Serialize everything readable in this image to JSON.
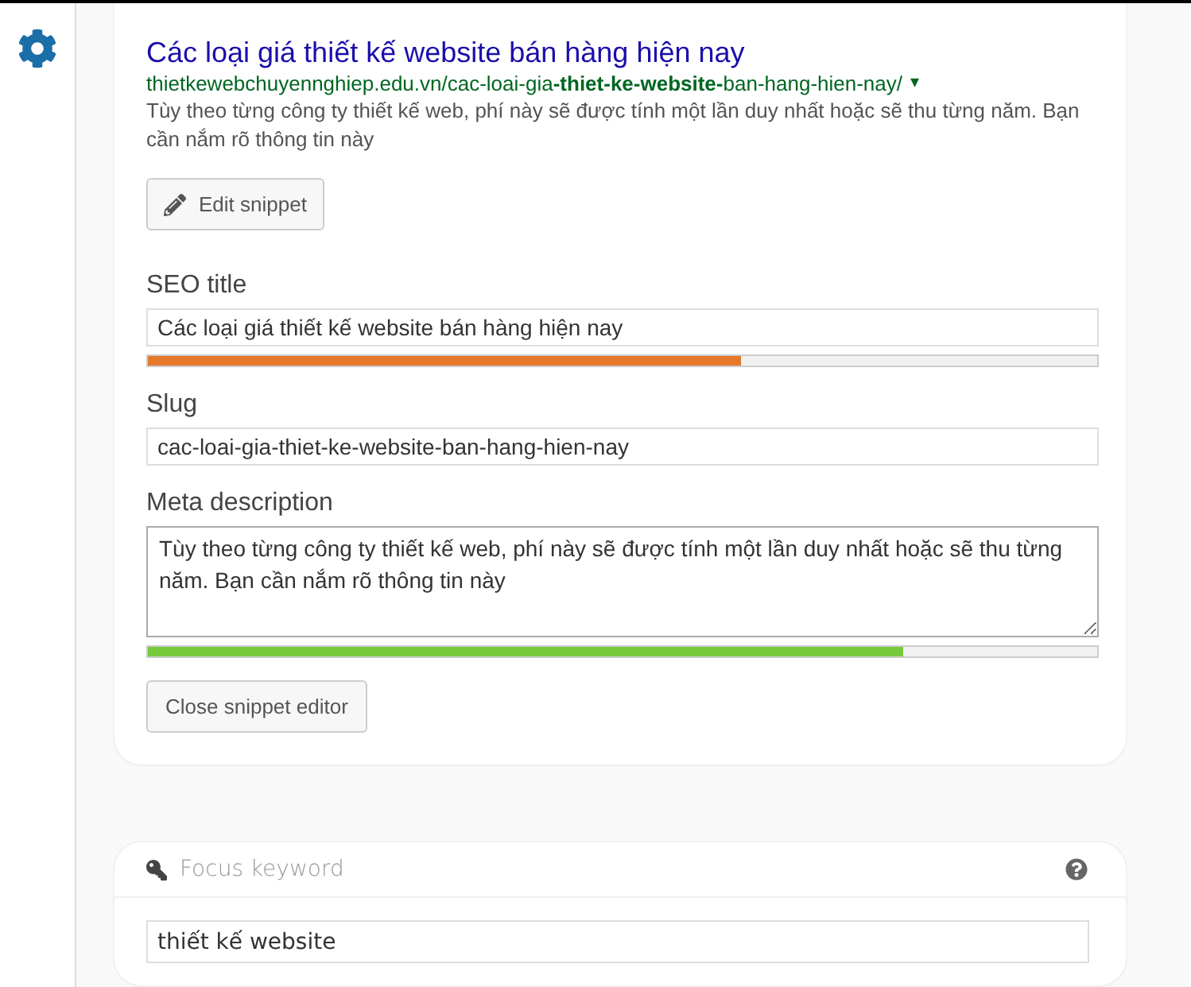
{
  "snippet": {
    "title": "Các loại giá thiết kế website bán hàng hiện nay",
    "url": "thietkewebchuyennghiep.edu.vn/cac-loai-gia**-thiet-ke-website-**ban-hang-hien-nay/",
    "url_caret": "▾",
    "description": "Tùy theo từng công ty thiết kế web, phí này sẽ được tính một lần duy nhất hoặc sẽ thu từng năm. Bạn cần nắm rõ thông tin này",
    "edit_button": "Edit snippet"
  },
  "fields": [
    {
      "kind": "input",
      "label": "SEO title",
      "value": "Các loại giá thiết kế website bán hàng hiện nay",
      "meter": {
        "level": 0.625,
        "color": "#e5782b"
      }
    },
    {
      "kind": "input",
      "label": "Slug",
      "value": "cac-loai-gia-thiet-ke-website-ban-hang-hien-nay"
    },
    {
      "kind": "textarea",
      "label": "Meta description",
      "value": "Tùy theo từng công ty thiết kế web, phí này sẽ được tính một lần duy nhất hoặc sẽ thu từng năm. Bạn cần nắm rõ thông tin này",
      "meter": {
        "level": 0.795,
        "color": "#77c93c"
      }
    }
  ],
  "close_button": "Close snippet editor",
  "focus": {
    "label": "Focus keyword",
    "value": "thiết kế website"
  }
}
